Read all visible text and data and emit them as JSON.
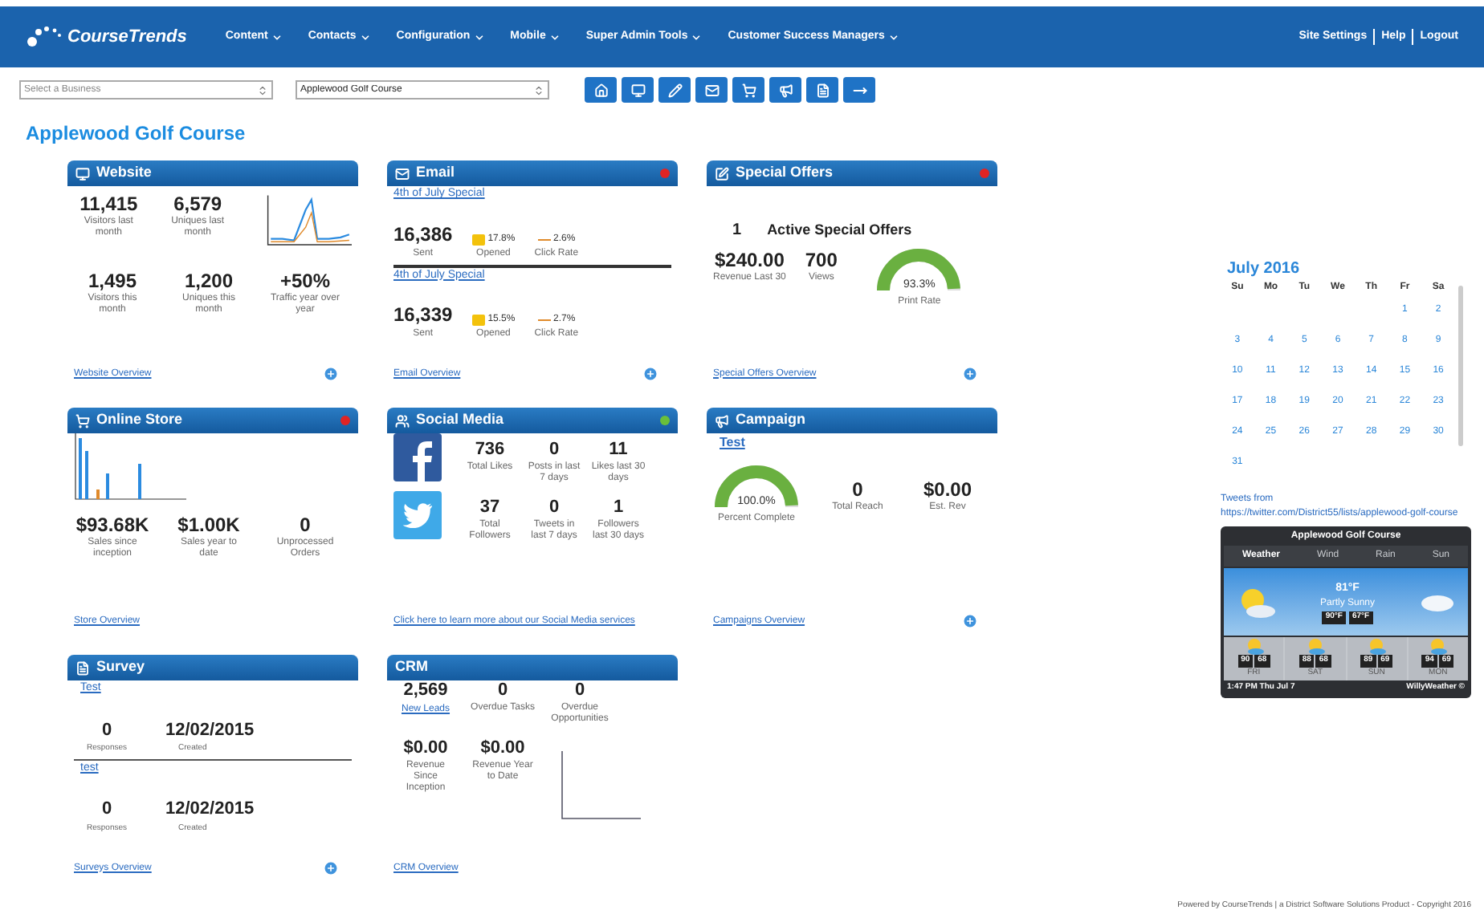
{
  "nav": {
    "logo": "CourseTrends",
    "menu": [
      "Content",
      "Contacts",
      "Configuration",
      "Mobile",
      "Super Admin Tools",
      "Customer Success Managers"
    ],
    "links": [
      "Site Settings",
      "Help",
      "Logout"
    ]
  },
  "toolbar": {
    "business_select": {
      "placeholder": "Select a Business"
    },
    "course_select": {
      "value": "Applewood Golf Course"
    }
  },
  "page_title": "Applewood Golf Course",
  "cards": [
    {
      "kind": "website",
      "title": "Website",
      "stats": [
        {
          "value": "11,415",
          "label": "Visitors last month"
        },
        {
          "value": "6,579",
          "label": "Uniques last month"
        },
        {
          "value": "1,495",
          "label": "Visitors this month"
        },
        {
          "value": "1,200",
          "label": "Uniques this month"
        },
        {
          "value": "+50%",
          "label": "Traffic year over year"
        }
      ],
      "footer": "Website Overview"
    },
    {
      "kind": "email",
      "title": "Email",
      "color": "#e02424",
      "campaigns": [
        {
          "name": "4th of July Special",
          "sent": "16,386",
          "sent_label": "Sent",
          "opened": "17.8%",
          "opened_label": "Opened",
          "click": "2.6%",
          "click_label": "Click Rate"
        },
        {
          "name": "4th of July Special",
          "sent": "16,339",
          "sent_label": "Sent",
          "opened": "15.5%",
          "opened_label": "Opened",
          "click": "2.7%",
          "click_label": "Click Rate"
        }
      ],
      "footer": "Email Overview"
    },
    {
      "kind": "offers",
      "title": "Special Offers",
      "color": "#e02424",
      "count": "1",
      "headline": "Active Special Offers",
      "stats": [
        {
          "value": "$240.00",
          "label": "Revenue Last 30"
        },
        {
          "value": "700",
          "label": "Views"
        }
      ],
      "gauge": {
        "reading": "93.3%",
        "label": "Print Rate"
      },
      "footer": "Special Offers Overview"
    },
    {
      "kind": "store",
      "title": "Online Store",
      "color": "#e02424",
      "stats": [
        {
          "value": "$93.68K",
          "label": "Sales since inception"
        },
        {
          "value": "$1.00K",
          "label": "Sales year to date"
        },
        {
          "value": "0",
          "label": "Unprocessed Orders"
        }
      ],
      "footer": "Store Overview"
    },
    {
      "kind": "social",
      "title": "Social Media",
      "color": "#6abf3a",
      "networks": [
        {
          "kind": "facebook",
          "stats": [
            {
              "value": "736",
              "label": "Total Likes"
            },
            {
              "value": "0",
              "label": "Posts in last 7 days"
            },
            {
              "value": "11",
              "label": "Likes last 30 days"
            }
          ]
        },
        {
          "kind": "twitter",
          "stats": [
            {
              "value": "37",
              "label": "Total Followers"
            },
            {
              "value": "0",
              "label": "Tweets in last 7 days"
            },
            {
              "value": "1",
              "label": "Followers last 30 days"
            }
          ]
        }
      ],
      "footer": "Click here to learn more about our Social Media services"
    },
    {
      "kind": "campaign",
      "title": "Campaign",
      "link": "Test",
      "gauge": {
        "reading": "100.0%",
        "label": "Percent Complete"
      },
      "stats": [
        {
          "value": "0",
          "label": "Total Reach"
        },
        {
          "value": "$0.00",
          "label": "Est. Rev"
        }
      ],
      "footer": "Campaigns Overview"
    },
    {
      "kind": "survey",
      "title": "Survey",
      "surveys": [
        {
          "name": "Test",
          "responses": "0",
          "responses_label": "Responses",
          "created": "12/02/2015",
          "created_label": "Created"
        },
        {
          "name": "test",
          "responses": "0",
          "responses_label": "Responses",
          "created": "12/02/2015",
          "created_label": "Created"
        }
      ],
      "footer": "Surveys Overview"
    },
    {
      "kind": "crm",
      "title": "CRM",
      "stats": [
        {
          "value": "2,569",
          "label": "New Leads",
          "kind": "link"
        },
        {
          "value": "0",
          "label": "Overdue Tasks",
          "kind": "text"
        },
        {
          "value": "0",
          "label": "Overdue Opportunities",
          "kind": "text"
        },
        {
          "value": "$0.00",
          "label": "Revenue Since Inception",
          "kind": "text"
        },
        {
          "value": "$0.00",
          "label": "Revenue Year to Date",
          "kind": "text"
        }
      ],
      "footer": "CRM Overview"
    }
  ],
  "calendar": {
    "month": "July 2016",
    "weekdays": [
      "Su",
      "Mo",
      "Tu",
      "We",
      "Th",
      "Fr",
      "Sa"
    ],
    "weeks": [
      [
        "1",
        "2"
      ],
      [
        "3",
        "4",
        "5",
        "6",
        "7",
        "8",
        "9"
      ],
      [
        "10",
        "11",
        "12",
        "13",
        "14",
        "15",
        "16"
      ],
      [
        "17",
        "18",
        "19",
        "20",
        "21",
        "22",
        "23"
      ],
      [
        "24",
        "25",
        "26",
        "27",
        "28",
        "29",
        "30"
      ],
      [
        "31"
      ]
    ]
  },
  "tweets": {
    "heading": "Tweets from",
    "url": "https://twitter.com/District55/lists/applewood-golf-course"
  },
  "weather": {
    "title": "Applewood Golf Course",
    "tabs": [
      {
        "label": "Weather",
        "selected": true
      },
      {
        "label": "Wind",
        "selected": false
      },
      {
        "label": "Rain",
        "selected": false
      },
      {
        "label": "Sun",
        "selected": false
      }
    ],
    "temperature": "81°F",
    "condition": "Partly Sunny",
    "high": "90°F",
    "low": "67°F",
    "forecast": [
      {
        "day": "FRI",
        "high": "90",
        "low": "68"
      },
      {
        "day": "SAT",
        "high": "88",
        "low": "68"
      },
      {
        "day": "SUN",
        "high": "89",
        "low": "69"
      },
      {
        "day": "MON",
        "high": "94",
        "low": "69"
      }
    ],
    "time": "1:47 PM Thu Jul 7",
    "brand": "WillyWeather ©"
  },
  "footer": "Powered by CourseTrends | a District Software Solutions Product - Copyright 2016"
}
